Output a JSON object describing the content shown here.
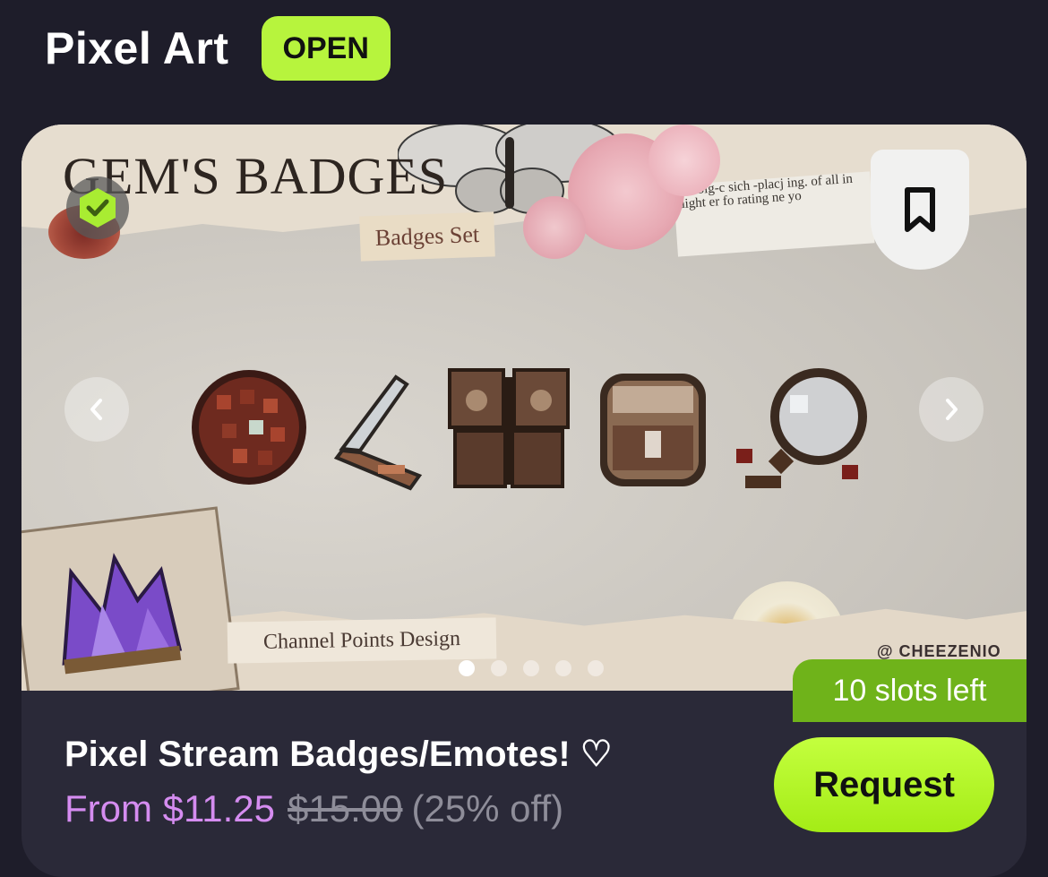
{
  "header": {
    "title": "Pixel Art",
    "status": "OPEN"
  },
  "listing": {
    "image": {
      "title_text": "GEM'S BADGES",
      "subtitle_text": "Badges Set",
      "footer_text": "Channel Points Design",
      "credit_text": "@ CHEEZENIO",
      "carousel_pages": 5,
      "carousel_active": 1
    },
    "slots_left": "10 slots left",
    "title": "Pixel Stream Badges/Emotes! ♡",
    "price_current": "From $11.25",
    "price_original": "$15.00",
    "price_discount": "(25% off)",
    "request_label": "Request"
  },
  "colors": {
    "background": "#1e1d2a",
    "card": "#2a2938",
    "accent_green": "#b7f43d",
    "slots_green": "#6fb31a",
    "price_purple": "#d58cf0",
    "muted": "#8e8d99"
  },
  "icons": {
    "verified": "verified-check-icon",
    "bookmark": "bookmark-icon",
    "prev": "chevron-left-icon",
    "next": "chevron-right-icon"
  }
}
